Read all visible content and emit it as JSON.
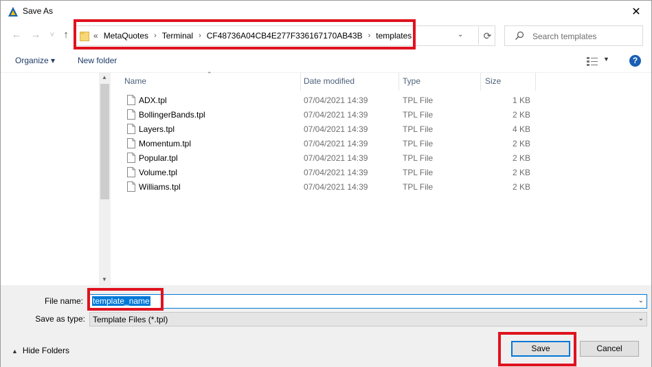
{
  "window": {
    "title": "Save As",
    "close_label": "✕"
  },
  "nav": {
    "back": "←",
    "forward": "→",
    "recent": "˅",
    "up": "↑"
  },
  "address": {
    "lead": "«",
    "crumbs": [
      "MetaQuotes",
      "Terminal",
      "CF48736A04CB4E277F336167170AB43B",
      "templates"
    ],
    "separator": "›"
  },
  "search": {
    "placeholder": "Search templates"
  },
  "toolbar": {
    "organize_label": "Organize ▾",
    "new_folder_label": "New folder",
    "help_label": "?"
  },
  "columns": {
    "name": "Name",
    "date": "Date modified",
    "type": "Type",
    "size": "Size"
  },
  "files": [
    {
      "name": "ADX.tpl",
      "date": "07/04/2021 14:39",
      "type": "TPL File",
      "size": "1 KB"
    },
    {
      "name": "BollingerBands.tpl",
      "date": "07/04/2021 14:39",
      "type": "TPL File",
      "size": "2 KB"
    },
    {
      "name": "Layers.tpl",
      "date": "07/04/2021 14:39",
      "type": "TPL File",
      "size": "4 KB"
    },
    {
      "name": "Momentum.tpl",
      "date": "07/04/2021 14:39",
      "type": "TPL File",
      "size": "2 KB"
    },
    {
      "name": "Popular.tpl",
      "date": "07/04/2021 14:39",
      "type": "TPL File",
      "size": "2 KB"
    },
    {
      "name": "Volume.tpl",
      "date": "07/04/2021 14:39",
      "type": "TPL File",
      "size": "2 KB"
    },
    {
      "name": "Williams.tpl",
      "date": "07/04/2021 14:39",
      "type": "TPL File",
      "size": "2 KB"
    }
  ],
  "form": {
    "file_name_label": "File name:",
    "file_name_value": "template_name",
    "save_type_label": "Save as type:",
    "save_type_value": "Template Files (*.tpl)"
  },
  "footer": {
    "hide_folders_label": "Hide Folders",
    "save_label": "Save",
    "cancel_label": "Cancel"
  },
  "colors": {
    "annotation_red": "#e0121f",
    "accent": "#0078d7"
  }
}
